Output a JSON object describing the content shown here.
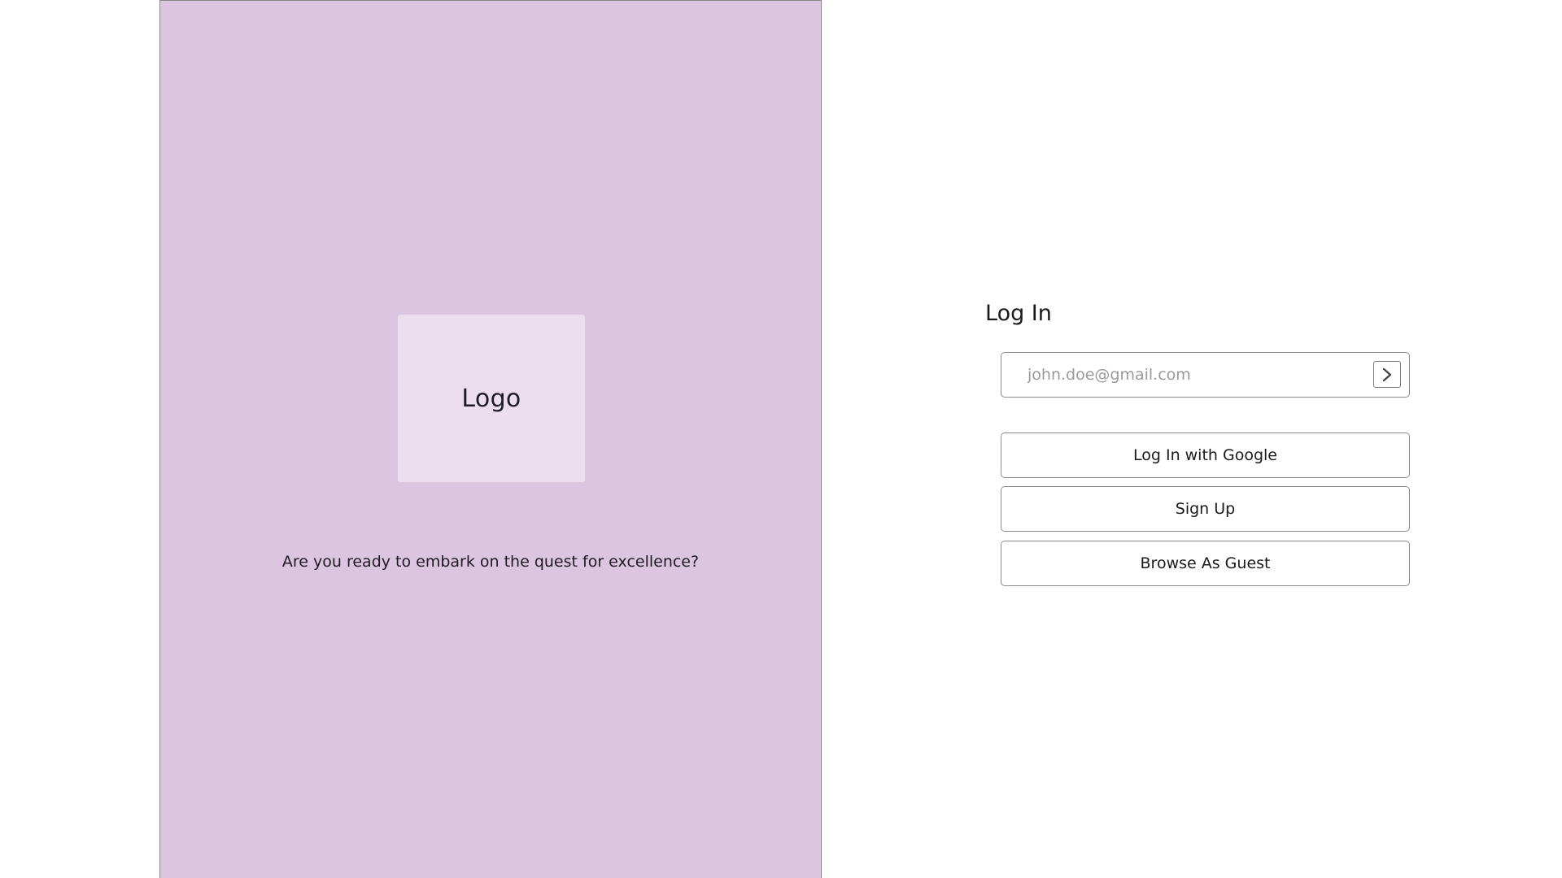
{
  "brand": {
    "logo_label": "Logo",
    "tagline": "Are you ready to embark on the quest for excellence?",
    "panel_color": "#dcc5e0",
    "logo_box_color": "#ecdeee"
  },
  "login": {
    "title": "Log In",
    "email": {
      "value": "",
      "placeholder": "john.doe@gmail.com",
      "submit_icon": "chevron-right-icon"
    },
    "buttons": {
      "google": "Log In with Google",
      "signup": "Sign Up",
      "guest": "Browse As Guest"
    }
  }
}
